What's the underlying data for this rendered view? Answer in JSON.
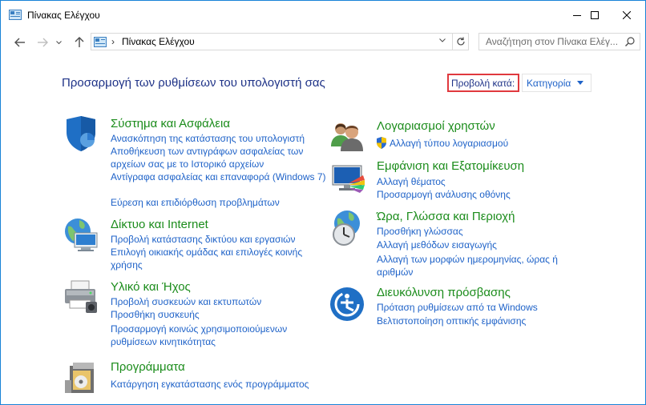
{
  "window": {
    "title": "Πίνακας Ελέγχου"
  },
  "nav": {
    "breadcrumb": "Πίνακας Ελέγχου",
    "search_placeholder": "Αναζήτηση στον Πίνακα Ελέγ..."
  },
  "main": {
    "heading": "Προσαρμογή των ρυθμίσεων του υπολογιστή σας",
    "view_by_label": "Προβολή κατά:",
    "view_by_value": "Κατηγορία"
  },
  "categories": {
    "system": {
      "title": "Σύστημα και Ασφάλεια",
      "links": [
        "Ανασκόπηση της κατάστασης του υπολογιστή",
        "Αποθήκευση των αντιγράφων ασφαλείας των αρχείων σας με το Ιστορικό αρχείων",
        "Αντίγραφα ασφαλείας και επαναφορά (Windows 7)",
        "Εύρεση και επιδιόρθωση προβλημάτων"
      ]
    },
    "network": {
      "title": "Δίκτυο και Internet",
      "links": [
        "Προβολή κατάστασης δικτύου και εργασιών",
        "Επιλογή οικιακής ομάδας και επιλογές κοινής χρήσης"
      ]
    },
    "hardware": {
      "title": "Υλικό και Ήχος",
      "links": [
        "Προβολή συσκευών και εκτυπωτών",
        "Προσθήκη συσκευής",
        "Προσαρμογή κοινώς χρησιμοποιούμενων ρυθμίσεων κινητικότητας"
      ]
    },
    "programs": {
      "title": "Προγράμματα",
      "links": [
        "Κατάργηση εγκατάστασης ενός προγράμματος"
      ]
    },
    "accounts": {
      "title": "Λογαριασμοί χρηστών",
      "links": [
        "Αλλαγή τύπου λογαριασμού"
      ]
    },
    "appearance": {
      "title": "Εμφάνιση και Εξατομίκευση",
      "links": [
        "Αλλαγή θέματος",
        "Προσαρμογή ανάλυσης οθόνης"
      ]
    },
    "clock": {
      "title": "Ώρα, Γλώσσα και Περιοχή",
      "links": [
        "Προσθήκη γλώσσας",
        "Αλλαγή μεθόδων εισαγωγής",
        "Αλλαγή των μορφών ημερομηνίας, ώρας ή αριθμών"
      ]
    },
    "ease": {
      "title": "Διευκόλυνση πρόσβασης",
      "links": [
        "Πρόταση ρυθμίσεων από τα Windows",
        "Βελτιστοποίηση οπτικής εμφάνισης"
      ]
    }
  },
  "colors": {
    "window_border": "#1883d7",
    "heading": "#1e3287",
    "category_title": "#1b8c1b",
    "link": "#1e62c8",
    "highlight_box": "#e0393e"
  }
}
